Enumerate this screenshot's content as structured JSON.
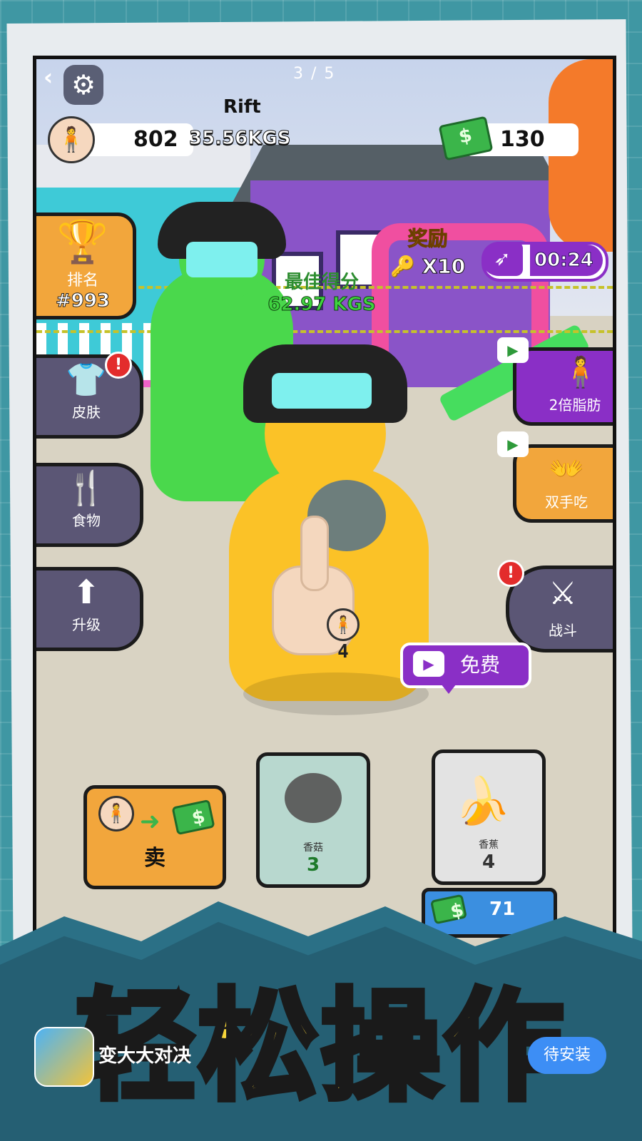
{
  "hud": {
    "back_icon": "‹",
    "settings_icon": "⚙",
    "pager": "3 / 5",
    "player_name": "Rift",
    "weight_value": "802",
    "weight_kgs": "35.56KGS",
    "cash_value": "130"
  },
  "rank": {
    "label": "排名",
    "value": "#993"
  },
  "reward": {
    "title": "奖励",
    "multiplier": "X10",
    "timer": "00:24"
  },
  "best_score": {
    "title": "最佳得分",
    "value": "62.97 KGS"
  },
  "left_menu": {
    "skin": "皮肤",
    "food": "食物",
    "upgrade": "升级",
    "alert": "!"
  },
  "right_menu": {
    "double_fat": "2倍脂肪",
    "two_hands": "双手吃",
    "fight": "战斗",
    "alert": "!"
  },
  "character": {
    "count": "4"
  },
  "bottom": {
    "sell_label": "卖",
    "mushroom": {
      "name": "香菇",
      "count": "3"
    },
    "banana": {
      "name": "香蕉",
      "count": "4"
    },
    "free_label": "免费",
    "price_value": "71"
  },
  "banner": {
    "slogan": "轻松操作",
    "app_name": "变大大对决",
    "install_label": "待安装"
  }
}
